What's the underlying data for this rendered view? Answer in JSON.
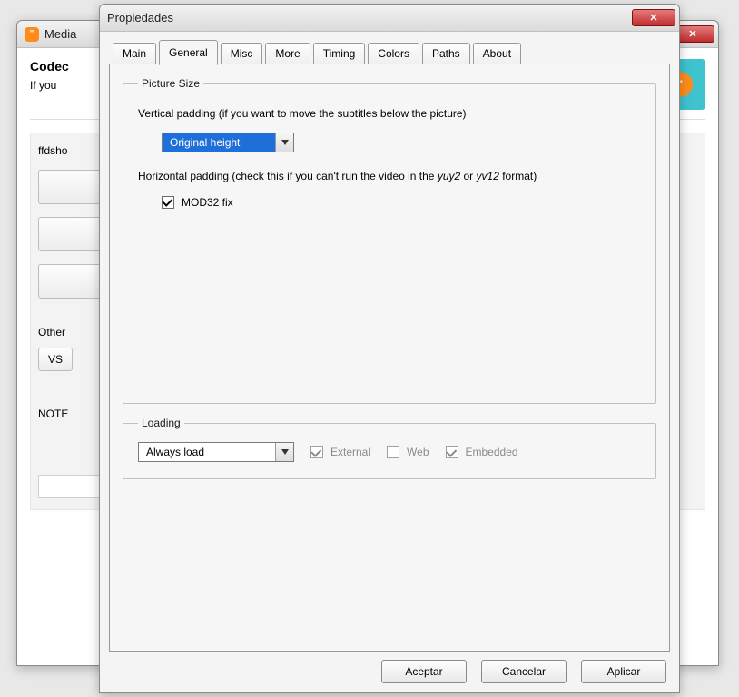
{
  "bg_window": {
    "title": "Media",
    "codec_label": "Codec",
    "codec_desc": "If you",
    "ffdshow_label": "ffdsho",
    "other_label": "Other",
    "vs_button": "VS",
    "note_label": "NOTE"
  },
  "dialog": {
    "title": "Propiedades",
    "tabs": [
      "Main",
      "General",
      "Misc",
      "More",
      "Timing",
      "Colors",
      "Paths",
      "About"
    ],
    "active_tab": "General",
    "picture_size": {
      "legend": "Picture Size",
      "vpad_label": "Vertical padding (if you want to move the subtitles below the picture)",
      "vpad_value": "Original height",
      "hpad_label": "Horizontal padding (check this if you can't run the video in the yuy2 or yv12 format)",
      "italic_1": "yuy2",
      "italic_2": "yv12",
      "mod32_label": "MOD32 fix",
      "mod32_checked": true
    },
    "loading": {
      "legend": "Loading",
      "mode_value": "Always load",
      "external_label": "External",
      "external_checked": true,
      "web_label": "Web",
      "web_checked": false,
      "embedded_label": "Embedded",
      "embedded_checked": true
    },
    "buttons": {
      "accept": "Aceptar",
      "cancel": "Cancelar",
      "apply": "Aplicar"
    }
  }
}
